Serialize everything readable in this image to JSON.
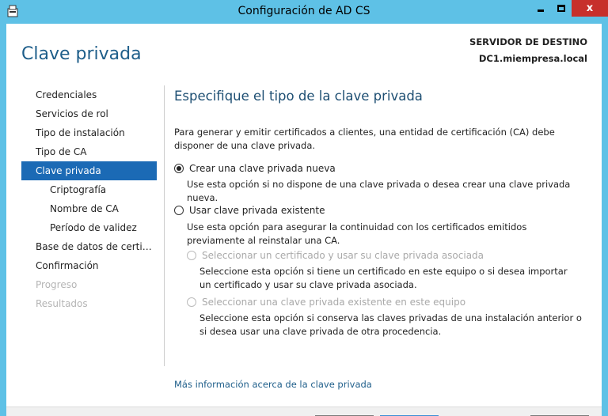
{
  "window": {
    "title": "Configuración de AD CS",
    "close_glyph": "x"
  },
  "page_title": "Clave privada",
  "destination": {
    "label": "SERVIDOR DE DESTINO",
    "server": "DC1.miempresa.local"
  },
  "nav": {
    "items": [
      {
        "label": "Credenciales",
        "state": "normal"
      },
      {
        "label": "Servicios de rol",
        "state": "normal"
      },
      {
        "label": "Tipo de instalación",
        "state": "normal"
      },
      {
        "label": "Tipo de CA",
        "state": "normal"
      },
      {
        "label": "Clave privada",
        "state": "active"
      },
      {
        "label": "Criptografía",
        "state": "sub"
      },
      {
        "label": "Nombre de CA",
        "state": "sub"
      },
      {
        "label": "Período de validez",
        "state": "sub"
      },
      {
        "label": "Base de datos de certifica...",
        "state": "normal"
      },
      {
        "label": "Confirmación",
        "state": "normal"
      },
      {
        "label": "Progreso",
        "state": "disabled"
      },
      {
        "label": "Resultados",
        "state": "disabled"
      }
    ]
  },
  "content": {
    "heading": "Especifique el tipo de la clave privada",
    "intro": "Para generar y emitir certificados a clientes, una entidad de certificación (CA) debe disponer de una clave privada.",
    "option_new": {
      "label": "Crear una clave privada nueva",
      "description": "Use esta opción si no dispone de una clave privada o desea crear una clave privada nueva.",
      "selected": true
    },
    "option_existing": {
      "label": "Usar clave privada existente",
      "description": "Use esta opción para asegurar la continuidad con los certificados emitidos previamente al reinstalar una CA.",
      "selected": false
    },
    "sub_option_cert": {
      "label": "Seleccionar un certificado y usar su clave privada asociada",
      "description": "Seleccione esta opción si tiene un certificado en este equipo o si desea importar un certificado y usar su clave privada asociada.",
      "enabled": false
    },
    "sub_option_key": {
      "label": "Seleccionar una clave privada existente en este equipo",
      "description": "Seleccione esta opción si conserva las claves privadas de una instalación anterior o si desea usar una clave privada de otra procedencia.",
      "enabled": false
    },
    "more_info_link": "Más información acerca de la clave privada"
  },
  "colors": {
    "titlebar": "#5ec1e6",
    "close_button": "#c7302b",
    "nav_active": "#1b6ab5",
    "title_text": "#1e5e8a"
  }
}
